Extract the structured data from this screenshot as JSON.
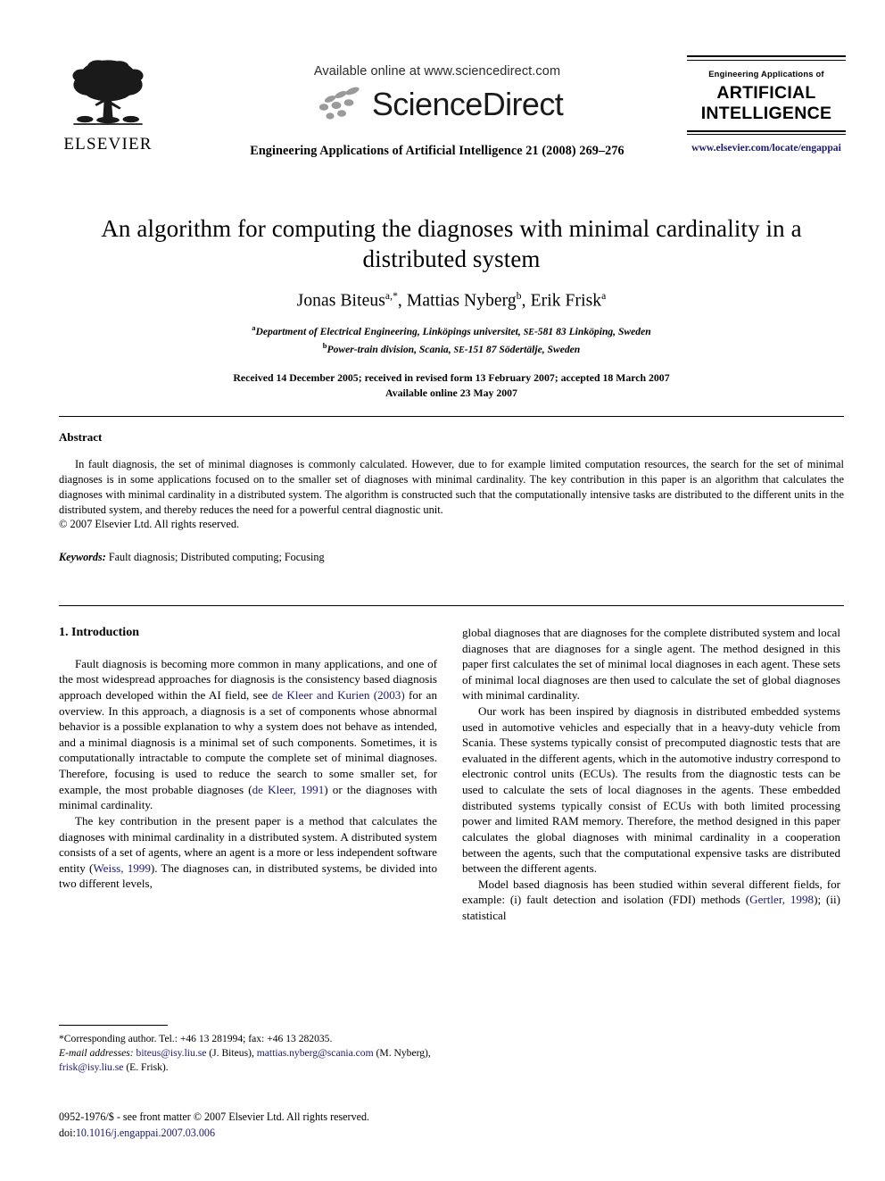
{
  "header": {
    "publisher_name": "ELSEVIER",
    "available_online": "Available online at www.sciencedirect.com",
    "sciencedirect_wordmark": "ScienceDirect",
    "journal_reference": "Engineering Applications of Artificial Intelligence 21 (2008) 269–276",
    "journal_logo_sub": "Engineering Applications of",
    "journal_logo_line1": "ARTIFICIAL",
    "journal_logo_line2": "INTELLIGENCE",
    "journal_url": "www.elsevier.com/locate/engappai",
    "link_color": "#191970"
  },
  "article": {
    "title": "An algorithm for computing the diagnoses with minimal cardinality in a distributed system",
    "authors": [
      {
        "name": "Jonas Biteus",
        "marks": "a,*"
      },
      {
        "name": "Mattias Nyberg",
        "marks": "b"
      },
      {
        "name": "Erik Frisk",
        "marks": "a"
      }
    ],
    "authors_separator": ", ",
    "affiliations": [
      {
        "mark": "a",
        "text": "Department of Electrical Engineering, Linköpings universitet, SE-581 83 Linköping, Sweden"
      },
      {
        "mark": "b",
        "text": "Power-train division, Scania, SE-151 87 Södertälje, Sweden"
      }
    ],
    "history_line1": "Received 14 December 2005; received in revised form 13 February 2007; accepted 18 March 2007",
    "history_line2": "Available online 23 May 2007"
  },
  "abstract": {
    "heading": "Abstract",
    "body": "In fault diagnosis, the set of minimal diagnoses is commonly calculated. However, due to for example limited computation resources, the search for the set of minimal diagnoses is in some applications focused on to the smaller set of diagnoses with minimal cardinality. The key contribution in this paper is an algorithm that calculates the diagnoses with minimal cardinality in a distributed system. The algorithm is constructed such that the computationally intensive tasks are distributed to the different units in the distributed system, and thereby reduces the need for a powerful central diagnostic unit.",
    "copyright": "© 2007 Elsevier Ltd. All rights reserved.",
    "keywords_label": "Keywords:",
    "keywords_value": "Fault diagnosis; Distributed computing; Focusing"
  },
  "body": {
    "section_number_title": "1. Introduction",
    "left_paragraphs": [
      {
        "segments": [
          {
            "t": "Fault diagnosis is becoming more common in many applications, and one of the most widespread approaches for diagnosis is the consistency based diagnosis approach developed within the AI field, see ",
            "cite": false
          },
          {
            "t": "de Kleer and Kurien (2003)",
            "cite": true
          },
          {
            "t": " for an overview. In this approach, a diagnosis is a set of components whose abnormal behavior is a possible explanation to why a system does not behave as intended, and a minimal diagnosis is a minimal set of such components. Sometimes, it is computationally intractable to compute the complete set of minimal diagnoses. Therefore, focusing is used to reduce the search to some smaller set, for example, the most probable diagnoses (",
            "cite": false
          },
          {
            "t": "de Kleer, 1991",
            "cite": true
          },
          {
            "t": ") or the diagnoses with minimal cardinality.",
            "cite": false
          }
        ]
      },
      {
        "segments": [
          {
            "t": "The key contribution in the present paper is a method that calculates the diagnoses with minimal cardinality in a distributed system. A distributed system consists of a set of agents, where an agent is a more or less independent software entity (",
            "cite": false
          },
          {
            "t": "Weiss, 1999",
            "cite": true
          },
          {
            "t": "). The diagnoses can, in distributed systems, be divided into two different levels,",
            "cite": false
          }
        ]
      }
    ],
    "right_paragraphs": [
      {
        "indent": false,
        "segments": [
          {
            "t": "global diagnoses that are diagnoses for the complete distributed system and local diagnoses that are diagnoses for a single agent. The method designed in this paper first calculates the set of minimal local diagnoses in each agent. These sets of minimal local diagnoses are then used to calculate the set of global diagnoses with minimal cardinality.",
            "cite": false
          }
        ]
      },
      {
        "indent": true,
        "segments": [
          {
            "t": "Our work has been inspired by diagnosis in distributed embedded systems used in automotive vehicles and especially that in a heavy-duty vehicle from Scania. These systems typically consist of precomputed diagnostic tests that are evaluated in the different agents, which in the automotive industry correspond to electronic control units (ECUs). The results from the diagnostic tests can be used to calculate the sets of local diagnoses in the agents. These embedded distributed systems typically consist of ECUs with both limited processing power and limited RAM memory. Therefore, the method designed in this paper calculates the global diagnoses with minimal cardinality in a cooperation between the agents, such that the computational expensive tasks are distributed between the different agents.",
            "cite": false
          }
        ]
      },
      {
        "indent": true,
        "segments": [
          {
            "t": "Model based diagnosis has been studied within several different fields, for example: (i) fault detection and isolation (FDI) methods (",
            "cite": false
          },
          {
            "t": "Gertler, 1998",
            "cite": true
          },
          {
            "t": "); (ii) statistical",
            "cite": false
          }
        ]
      }
    ]
  },
  "footnotes": {
    "corresponding": "*Corresponding author. Tel.: +46 13 281994; fax: +46 13 282035.",
    "email_label": "E-mail addresses:",
    "email_1": "biteus@isy.liu.se",
    "email_1_owner": "(J. Biteus),",
    "email_2": "mattias.nyberg@scania.com",
    "email_2_owner": "(M. Nyberg),",
    "email_3": "frisk@isy.liu.se",
    "email_3_owner": "(E. Frisk).",
    "imprint_line": "0952-1976/$ - see front matter © 2007 Elsevier Ltd. All rights reserved.",
    "doi_label": "doi:",
    "doi_value": "10.1016/j.engappai.2007.03.006"
  }
}
